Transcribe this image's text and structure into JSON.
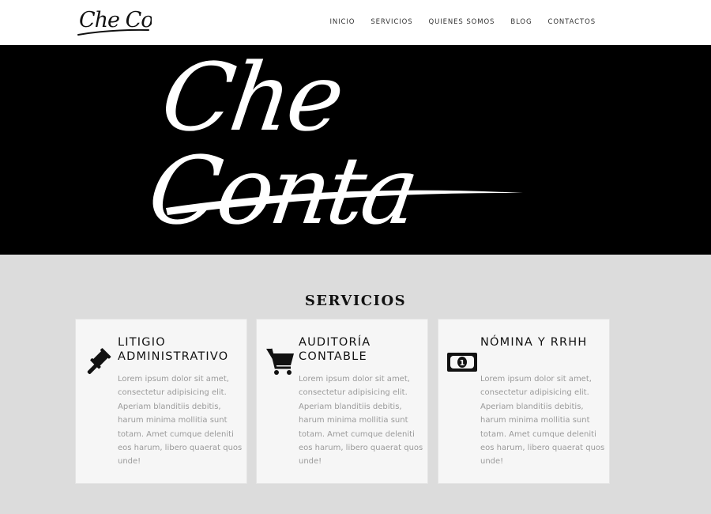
{
  "header": {
    "logo_text": "Che Conta",
    "nav": [
      "INICIO",
      "SERVICIOS",
      "QUIENES SOMOS",
      "BLOG",
      "CONTACTOS"
    ]
  },
  "hero": {
    "logo_text": "Che Conta",
    "background_color": "#000000"
  },
  "services": {
    "title": "SERVICIOS",
    "cards": [
      {
        "icon": "gavel-icon",
        "title": "LITIGIO ADMINISTRATIVO",
        "text": "Lorem ipsum dolor sit amet, consectetur adipisicing elit. Aperiam blanditiis debitis, harum minima mollitia sunt totam. Amet cumque deleniti eos harum, libero quaerat quos unde!"
      },
      {
        "icon": "shopping-cart-icon",
        "title": "AUDITORÍA CONTABLE",
        "text": "Lorem ipsum dolor sit amet, consectetur adipisicing elit. Aperiam blanditiis debitis, harum minima mollitia sunt totam. Amet cumque deleniti eos harum, libero quaerat quos unde!"
      },
      {
        "icon": "banknote-icon",
        "title": "NÓMINA Y RRHH",
        "text": "Lorem ipsum dolor sit amet, consectetur adipisicing elit. Aperiam blanditiis debitis, harum minima mollitia sunt totam. Amet cumque deleniti eos harum, libero quaerat quos unde!"
      }
    ]
  }
}
